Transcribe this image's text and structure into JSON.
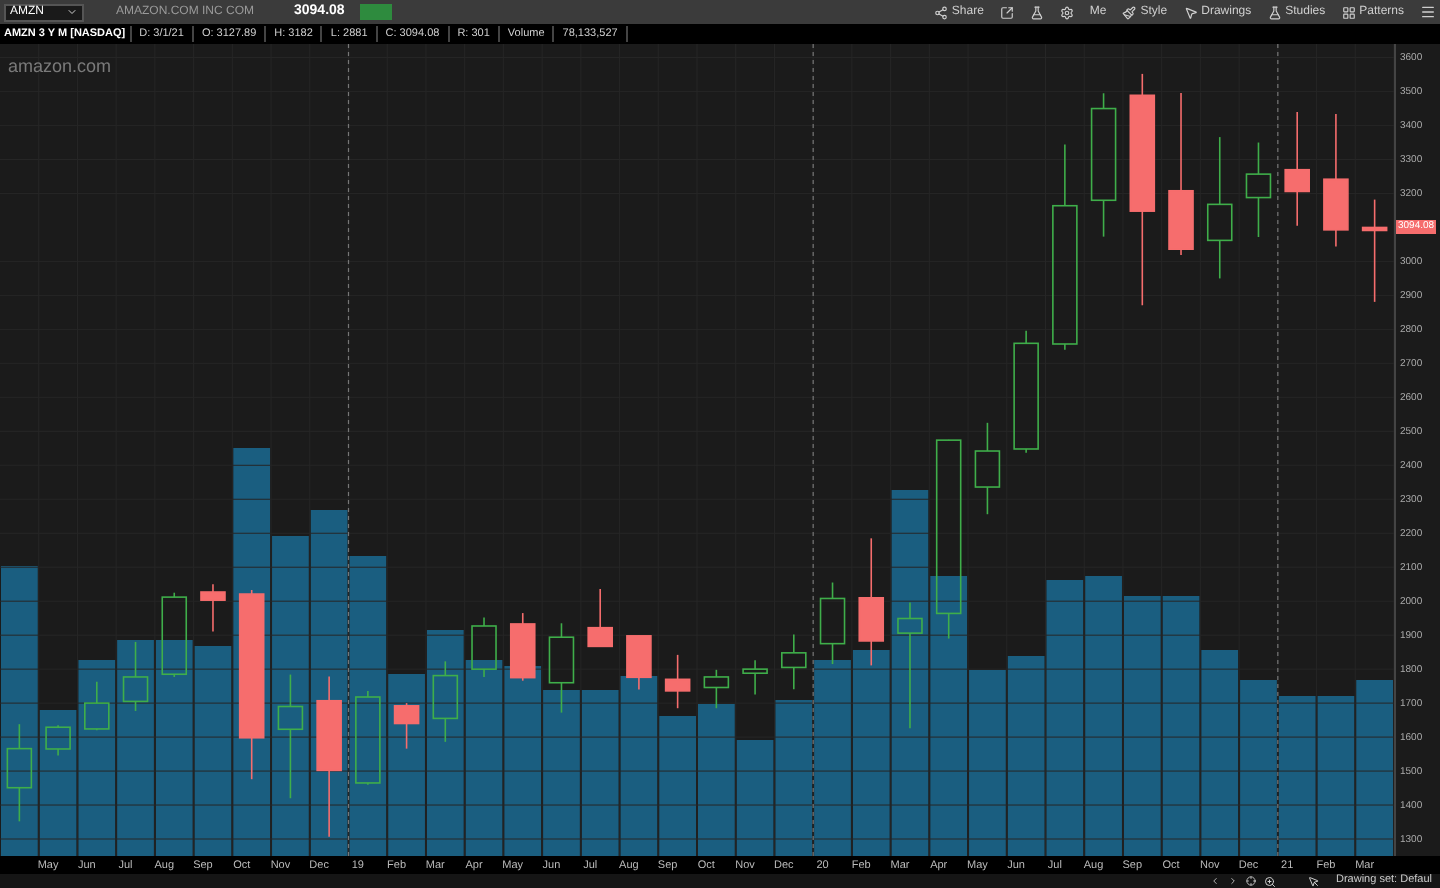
{
  "toolbar": {
    "symbol": "AMZN",
    "company": "AMAZON.COM INC COM",
    "last_price": "3094.08",
    "buttons": [
      {
        "label": "Share",
        "kind": "share"
      },
      {
        "label": "Me",
        "kind": "plain"
      },
      {
        "label": "Style",
        "kind": "style"
      },
      {
        "label": "Drawings",
        "kind": "drawings"
      },
      {
        "label": "Studies",
        "kind": "studies"
      },
      {
        "label": "Patterns",
        "kind": "patterns"
      }
    ]
  },
  "info_bar": {
    "title": "AMZN 3 Y M [NASDAQ]",
    "fields": [
      "D: 3/1/21",
      "O: 3127.89",
      "H: 3182",
      "L: 2881",
      "C: 3094.08",
      "R: 301",
      "Volume",
      "78,133,527"
    ]
  },
  "chart": {
    "logo": "amazon.com",
    "current_price": "3094.08",
    "chart_data": {
      "type": "candlestick",
      "categories": [
        null,
        "May",
        "Jun",
        "Jul",
        "Aug",
        "Sep",
        "Oct",
        "Nov",
        "Dec",
        "19",
        "Feb",
        "Mar",
        "Apr",
        "May",
        "Jun",
        "Jul",
        "Aug",
        "Sep",
        "Oct",
        "Nov",
        "Dec",
        "20",
        "Feb",
        "Mar",
        "Apr",
        "May",
        "Jun",
        "Jul",
        "Aug",
        "Sep",
        "Oct",
        "Nov",
        "Dec",
        "21",
        "Feb",
        "Mar"
      ],
      "ohlc": [
        [
          1451,
          1638,
          1352,
          1566
        ],
        [
          1565,
          1635,
          1546,
          1629
        ],
        [
          1624,
          1763,
          1620,
          1700
        ],
        [
          1705,
          1880,
          1677,
          1777
        ],
        [
          1785,
          2025,
          1777,
          2012
        ],
        [
          2027,
          2050,
          1911,
          2003
        ],
        [
          2021,
          2033,
          1476,
          1598
        ],
        [
          1623,
          1784,
          1420,
          1690
        ],
        [
          1707,
          1778,
          1307,
          1502
        ],
        [
          1465,
          1736,
          1460,
          1718
        ],
        [
          1692,
          1700,
          1566,
          1640
        ],
        [
          1655,
          1823,
          1586,
          1781
        ],
        [
          1800,
          1952,
          1777,
          1927
        ],
        [
          1933,
          1965,
          1766,
          1775
        ],
        [
          1760,
          1935,
          1672,
          1894
        ],
        [
          1922,
          2036,
          1866,
          1867
        ],
        [
          1898,
          1899,
          1740,
          1776
        ],
        [
          1770,
          1842,
          1685,
          1736
        ],
        [
          1746,
          1798,
          1685,
          1777
        ],
        [
          1788,
          1826,
          1725,
          1800
        ],
        [
          1805,
          1902,
          1741,
          1848
        ],
        [
          1875,
          2055,
          1815,
          2008
        ],
        [
          2010,
          2185,
          1811,
          1883
        ],
        [
          1906,
          1996,
          1626,
          1949
        ],
        [
          1964,
          2475,
          1890,
          2474
        ],
        [
          2336,
          2525,
          2256,
          2442
        ],
        [
          2448,
          2796,
          2437,
          2759
        ],
        [
          2757,
          3344,
          2740,
          3164
        ],
        [
          3180,
          3495,
          3073,
          3450
        ],
        [
          3489,
          3552,
          2871,
          3148
        ],
        [
          3208,
          3496,
          3019,
          3036
        ],
        [
          3062,
          3366,
          2950,
          3168
        ],
        [
          3188,
          3350,
          3072,
          3257
        ],
        [
          3270,
          3440,
          3105,
          3206
        ],
        [
          3242,
          3434,
          3044,
          3093
        ],
        [
          3100,
          3182,
          2881,
          3094
        ]
      ],
      "ylim": [
        1250,
        3640
      ],
      "grid": true,
      "yticks": [
        3600,
        3500,
        3400,
        3300,
        3200,
        3000,
        2900,
        2800,
        2700,
        2600,
        2500,
        2400,
        2300,
        2200,
        2100,
        2000,
        1900,
        1800,
        1700,
        1600,
        1500,
        1400,
        1300
      ]
    }
  },
  "status_bar": {
    "text": "Drawing set: Defaul"
  }
}
